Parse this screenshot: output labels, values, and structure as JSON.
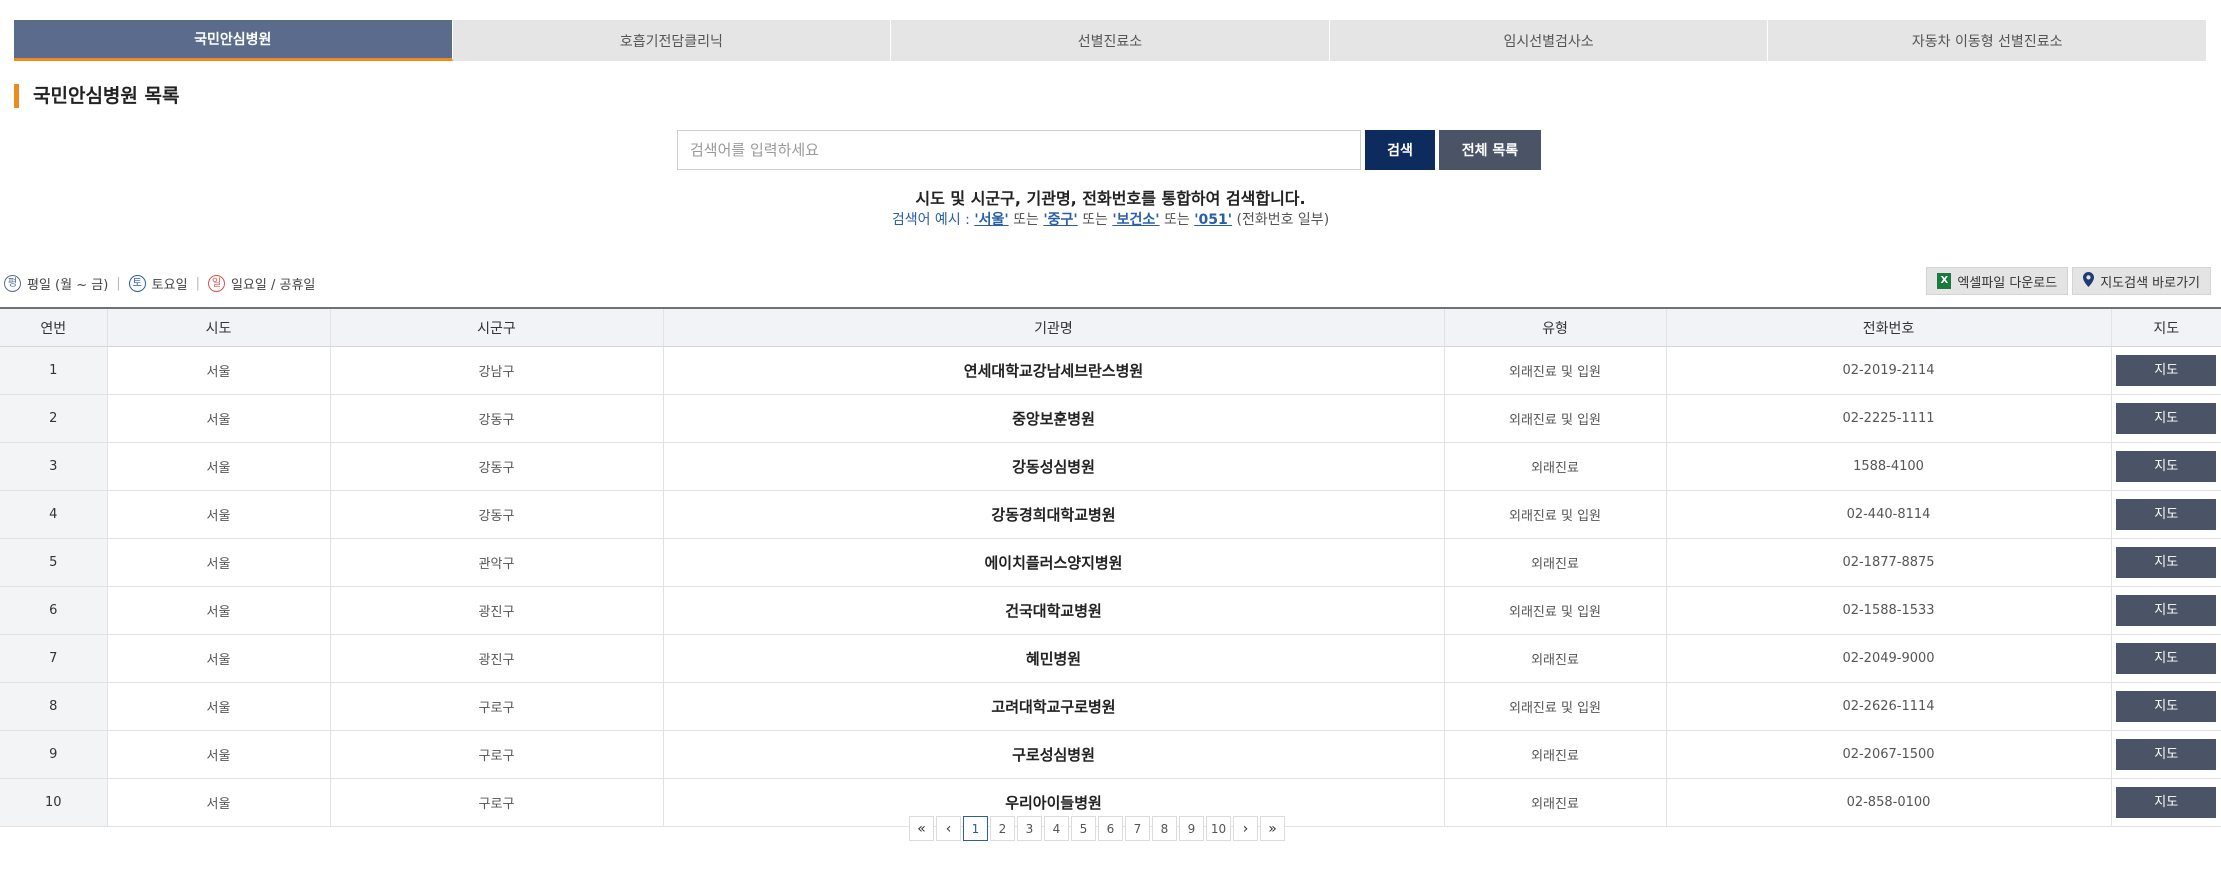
{
  "tabs": [
    {
      "label": "국민안심병원",
      "active": true
    },
    {
      "label": "호흡기전담클리닉",
      "active": false
    },
    {
      "label": "선별진료소",
      "active": false
    },
    {
      "label": "임시선별검사소",
      "active": false
    },
    {
      "label": "자동차 이동형 선별진료소",
      "active": false
    }
  ],
  "section_title": "국민안심병원 목록",
  "search": {
    "placeholder": "검색어를 입력하세요",
    "value": "",
    "search_label": "검색",
    "all_label": "전체 목록"
  },
  "hint": {
    "line1": "시도 및 시군구, 기관명, 전화번호를 통합하여 검색합니다.",
    "prefix": "검색어 예시 :",
    "ex1": "'서울'",
    "or1": "또는",
    "ex2": "'중구'",
    "or2": "또는",
    "ex3": "'보건소'",
    "or3": "또는",
    "ex4": "'051'",
    "suffix": "(전화번호 일부)"
  },
  "legend": {
    "weekday_icon": "평",
    "weekday": "평일 (월 ~ 금)",
    "saturday_icon": "토",
    "saturday": "토요일",
    "sunday_icon": "일",
    "sunday": "일요일 / 공휴일"
  },
  "tools": {
    "excel_icon": "X",
    "excel": "엑셀파일 다운로드",
    "map": "지도검색 바로가기"
  },
  "table": {
    "headers": [
      "연번",
      "시도",
      "시군구",
      "기관명",
      "유형",
      "전화번호",
      "지도"
    ],
    "map_button": "지도",
    "rows": [
      {
        "no": "1",
        "sido": "서울",
        "sigungu": "강남구",
        "name": "연세대학교강남세브란스병원",
        "type": "외래진료 및 입원",
        "phone": "02-2019-2114"
      },
      {
        "no": "2",
        "sido": "서울",
        "sigungu": "강동구",
        "name": "중앙보훈병원",
        "type": "외래진료 및 입원",
        "phone": "02-2225-1111"
      },
      {
        "no": "3",
        "sido": "서울",
        "sigungu": "강동구",
        "name": "강동성심병원",
        "type": "외래진료",
        "phone": "1588-4100"
      },
      {
        "no": "4",
        "sido": "서울",
        "sigungu": "강동구",
        "name": "강동경희대학교병원",
        "type": "외래진료 및 입원",
        "phone": "02-440-8114"
      },
      {
        "no": "5",
        "sido": "서울",
        "sigungu": "관악구",
        "name": "에이치플러스양지병원",
        "type": "외래진료",
        "phone": "02-1877-8875"
      },
      {
        "no": "6",
        "sido": "서울",
        "sigungu": "광진구",
        "name": "건국대학교병원",
        "type": "외래진료 및 입원",
        "phone": "02-1588-1533"
      },
      {
        "no": "7",
        "sido": "서울",
        "sigungu": "광진구",
        "name": "혜민병원",
        "type": "외래진료",
        "phone": "02-2049-9000"
      },
      {
        "no": "8",
        "sido": "서울",
        "sigungu": "구로구",
        "name": "고려대학교구로병원",
        "type": "외래진료 및 입원",
        "phone": "02-2626-1114"
      },
      {
        "no": "9",
        "sido": "서울",
        "sigungu": "구로구",
        "name": "구로성심병원",
        "type": "외래진료",
        "phone": "02-2067-1500"
      },
      {
        "no": "10",
        "sido": "서울",
        "sigungu": "구로구",
        "name": "우리아이들병원",
        "type": "외래진료",
        "phone": "02-858-0100"
      }
    ]
  },
  "pagination": {
    "first": "«",
    "prev": "‹",
    "pages": [
      "1",
      "2",
      "3",
      "4",
      "5",
      "6",
      "7",
      "8",
      "9",
      "10"
    ],
    "current": "1",
    "next": "›",
    "last": "»"
  },
  "colors": {
    "tab_active": "#5a6b8c",
    "accent": "#ef8a1f",
    "search_button": "#0d2b5c",
    "dark_button": "#4a5466",
    "link": "#2a5ea8"
  }
}
